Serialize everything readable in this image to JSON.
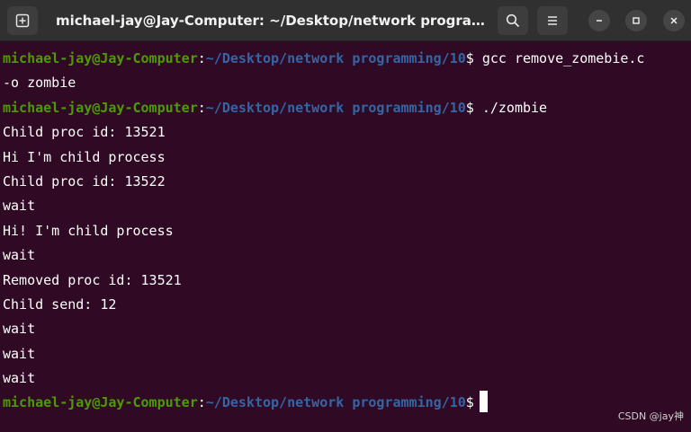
{
  "window": {
    "title": "michael-jay@Jay-Computer: ~/Desktop/network programmin...",
    "icons": {
      "new_tab": "new-tab-icon",
      "search": "search-icon",
      "menu": "hamburger-menu-icon",
      "minimize": "minimize-icon",
      "maximize": "maximize-icon",
      "close": "close-icon"
    }
  },
  "terminal": {
    "colors": {
      "background": "#300a24",
      "user_host": "#4e9a06",
      "path": "#3465a4",
      "text": "#ffffff"
    },
    "prompt": {
      "user_host": "michael-jay@Jay-Computer",
      "colon": ":",
      "path": "~/Desktop/network programming/10",
      "symbol": "$"
    },
    "lines": [
      {
        "type": "prompt",
        "command": " gcc remove_zomebie.c"
      },
      {
        "type": "output",
        "text": "-o zombie"
      },
      {
        "type": "prompt",
        "command": " ./zombie"
      },
      {
        "type": "output",
        "text": "Child proc id: 13521"
      },
      {
        "type": "output",
        "text": "Hi I'm child process"
      },
      {
        "type": "output",
        "text": "Child proc id: 13522"
      },
      {
        "type": "output",
        "text": "wait"
      },
      {
        "type": "output",
        "text": "Hi! I'm child process"
      },
      {
        "type": "output",
        "text": "wait"
      },
      {
        "type": "output",
        "text": "Removed proc id: 13521"
      },
      {
        "type": "output",
        "text": "Child send: 12"
      },
      {
        "type": "output",
        "text": "wait"
      },
      {
        "type": "output",
        "text": "wait"
      },
      {
        "type": "output",
        "text": "wait"
      },
      {
        "type": "prompt",
        "command": ""
      }
    ]
  },
  "watermark": "CSDN @jay神"
}
